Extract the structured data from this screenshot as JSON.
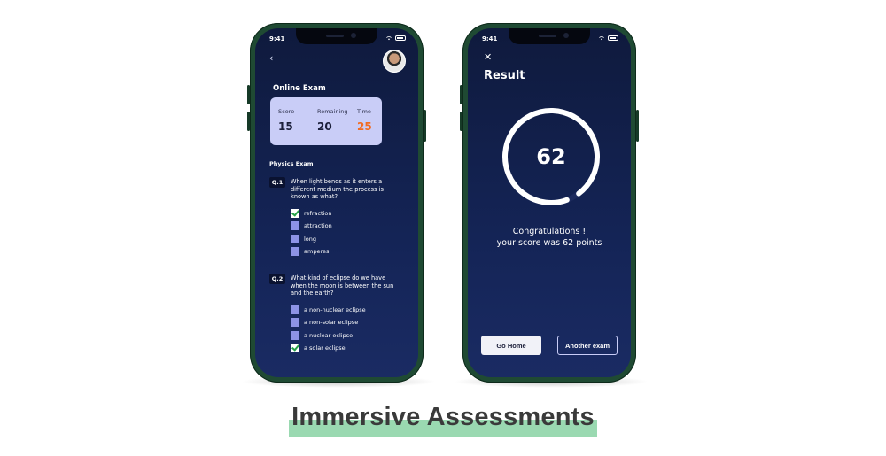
{
  "left_phone": {
    "status_time": "9:41",
    "icons": {
      "back": "back-icon",
      "avatar": "avatar-photo"
    },
    "exam_title": "Online Exam",
    "score_card": {
      "score_label": "Score",
      "score_value": "15",
      "remaining_label": "Remaining",
      "remaining_value": "20",
      "time_label": "Time",
      "time_value": "25"
    },
    "section_title": "Physics Exam",
    "questions": [
      {
        "number": "Q.1",
        "text": "When light bends as it enters a different medium the process is known as what?",
        "options": [
          {
            "label": "refraction",
            "checked": true
          },
          {
            "label": "attraction",
            "checked": false
          },
          {
            "label": "long",
            "checked": false
          },
          {
            "label": "amperes",
            "checked": false
          }
        ]
      },
      {
        "number": "Q.2",
        "text": "What kind of eclipse do we have when the moon is between the sun and the earth?",
        "options": [
          {
            "label": "a non-nuclear eclipse",
            "checked": false
          },
          {
            "label": "a non-solar eclipse",
            "checked": false
          },
          {
            "label": "a nuclear eclipse",
            "checked": false
          },
          {
            "label": "a solar eclipse",
            "checked": true
          }
        ]
      }
    ]
  },
  "right_phone": {
    "status_time": "9:41",
    "icons": {
      "close": "close-icon"
    },
    "title": "Result",
    "score": "62",
    "score_fraction": 0.62,
    "congrats_line1": "Congratulations !",
    "congrats_line2": "your score was 62 points",
    "buttons": {
      "home": "Go Home",
      "another": "Another exam"
    }
  },
  "caption": "Immersive Assessments",
  "colors": {
    "screen_bg": "#142456",
    "phone_frame": "#1f4a33",
    "card_bg": "#c9cdf7",
    "accent_orange": "#f26b21",
    "checkbox": "#8d93e6",
    "check_green": "#24a147",
    "caption_highlight": "#9ad9b1"
  }
}
